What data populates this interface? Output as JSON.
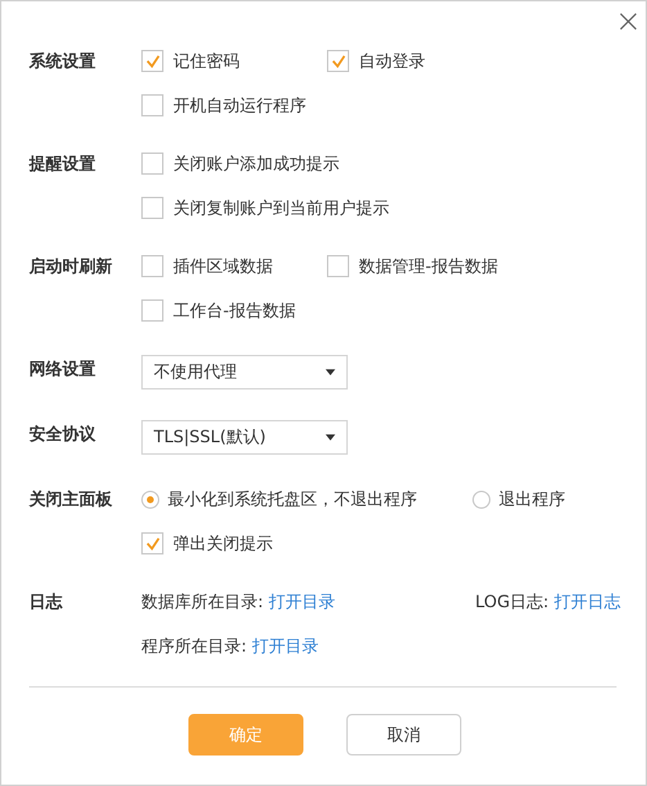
{
  "sections": [
    {
      "label": "系统设置",
      "rows": [
        [
          {
            "kind": "checkbox",
            "label": "记住密码",
            "checked": true
          },
          {
            "kind": "checkbox",
            "label": "自动登录",
            "checked": true
          }
        ],
        [
          {
            "kind": "checkbox",
            "label": "开机自动运行程序",
            "checked": false
          }
        ]
      ]
    },
    {
      "label": "提醒设置",
      "rows": [
        [
          {
            "kind": "checkbox",
            "label": "关闭账户添加成功提示",
            "checked": false
          }
        ],
        [
          {
            "kind": "checkbox",
            "label": "关闭复制账户到当前用户提示",
            "checked": false
          }
        ]
      ]
    },
    {
      "label": "启动时刷新",
      "rows": [
        [
          {
            "kind": "checkbox",
            "label": "插件区域数据",
            "checked": false
          },
          {
            "kind": "checkbox",
            "label": "数据管理-报告数据",
            "checked": false
          }
        ],
        [
          {
            "kind": "checkbox",
            "label": "工作台-报告数据",
            "checked": false
          }
        ]
      ]
    },
    {
      "label": "网络设置",
      "rows": [
        [
          {
            "kind": "select",
            "value": "不使用代理"
          }
        ]
      ]
    },
    {
      "label": "安全协议",
      "rows": [
        [
          {
            "kind": "select",
            "value": "TLS|SSL(默认)"
          }
        ]
      ]
    },
    {
      "label": "关闭主面板",
      "rows": [
        [
          {
            "kind": "radio",
            "label": "最小化到系统托盘区，不退出程序",
            "selected": true
          },
          {
            "kind": "radio",
            "label": "退出程序",
            "selected": false
          }
        ],
        [
          {
            "kind": "checkbox",
            "label": "弹出关闭提示",
            "checked": true
          }
        ]
      ]
    },
    {
      "label": "日志",
      "rows": [
        [
          {
            "kind": "link",
            "label": "数据库所在目录:",
            "link": "打开目录"
          },
          {
            "kind": "link",
            "label": "LOG日志:",
            "link": "打开日志"
          }
        ],
        [
          {
            "kind": "link",
            "label": "程序所在目录:",
            "link": "打开目录"
          }
        ]
      ]
    }
  ],
  "buttons": [
    {
      "label": "确定",
      "primary": true
    },
    {
      "label": "取消",
      "primary": false
    }
  ]
}
